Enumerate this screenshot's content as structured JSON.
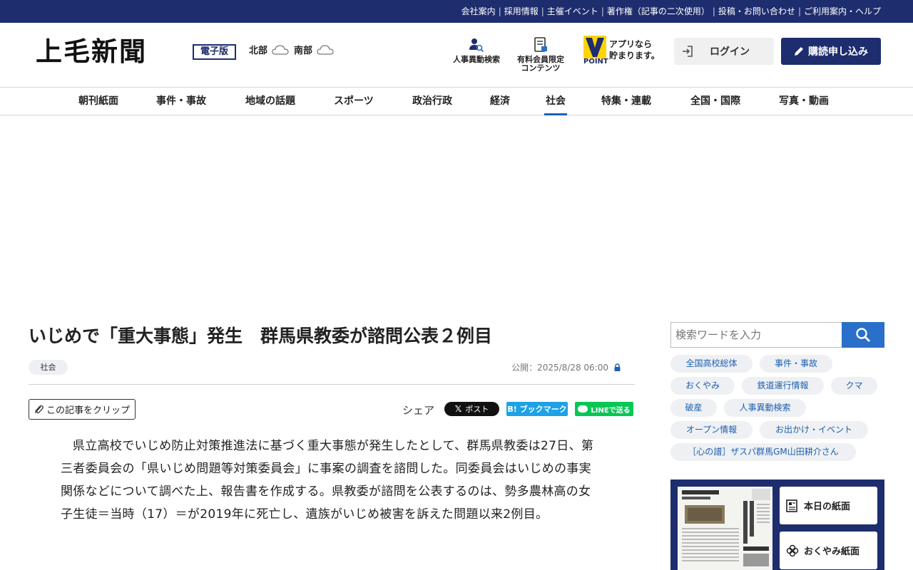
{
  "topbar": {
    "links": [
      "会社案内",
      "採用情報",
      "主催イベント",
      "著作権（記事の二次使用）",
      "投稿・お問い合わせ",
      "ご利用案内・ヘルプ"
    ]
  },
  "header": {
    "logo": "上毛新聞",
    "logo_sub": "電子版",
    "weather": [
      {
        "region": "北部",
        "icon": "cloud-icon"
      },
      {
        "region": "南部",
        "icon": "cloud-icon"
      }
    ],
    "personnel_search": "人事異動検索",
    "members_line1": "有料会員限定",
    "members_line2": "コンテンツ",
    "vpoint_label": "POINT",
    "app_line1": "アプリなら",
    "app_line2": "貯まります。",
    "login": "ログイン",
    "subscribe": "購読申し込み"
  },
  "nav": {
    "items": [
      "朝刊紙面",
      "事件・事故",
      "地域の話題",
      "スポーツ",
      "政治行政",
      "経済",
      "社会",
      "特集・連載",
      "全国・国際",
      "写真・動画"
    ],
    "active": "社会"
  },
  "article": {
    "title": "いじめで「重大事態」発生　群馬県教委が諮問公表２例目",
    "category": "社会",
    "published": "公開：2025/8/28 06:00",
    "clip": "この記事をクリップ",
    "share_label": "シェア",
    "share_x": "ポスト",
    "share_hatena": "B! ブックマーク",
    "share_line": "LINEで送る",
    "body": "県立高校でいじめ防止対策推進法に基づく重大事態が発生したとして、群馬県教委は27日、第三者委員会の「県いじめ問題等対策委員会」に事案の調査を諮問した。同委員会はいじめの事実関係などについて調べた上、報告書を作成する。県教委が諮問を公表するのは、勢多農林高の女子生徒＝当時（17）＝が2019年に死亡し、遺族がいじめ被害を訴えた問題以来2例目。"
  },
  "sidebar": {
    "search_placeholder": "検索ワードを入力",
    "keywords": [
      "全国高校総体",
      "事件・事故",
      "おくやみ",
      "鉄道運行情報",
      "クマ",
      "破産",
      "人事異動検索",
      "オープン情報",
      "お出かけ・イベント",
      "［心の譜］ザスパ群馬GM山田耕介さん"
    ],
    "today_paper": "本日の紙面",
    "obituary_paper": "おくやみ紙面"
  },
  "colors": {
    "brand_navy": "#1e2d6e",
    "accent_blue": "#2a6fc9",
    "line_green": "#06c755",
    "hatena_blue": "#1fa1e8"
  }
}
